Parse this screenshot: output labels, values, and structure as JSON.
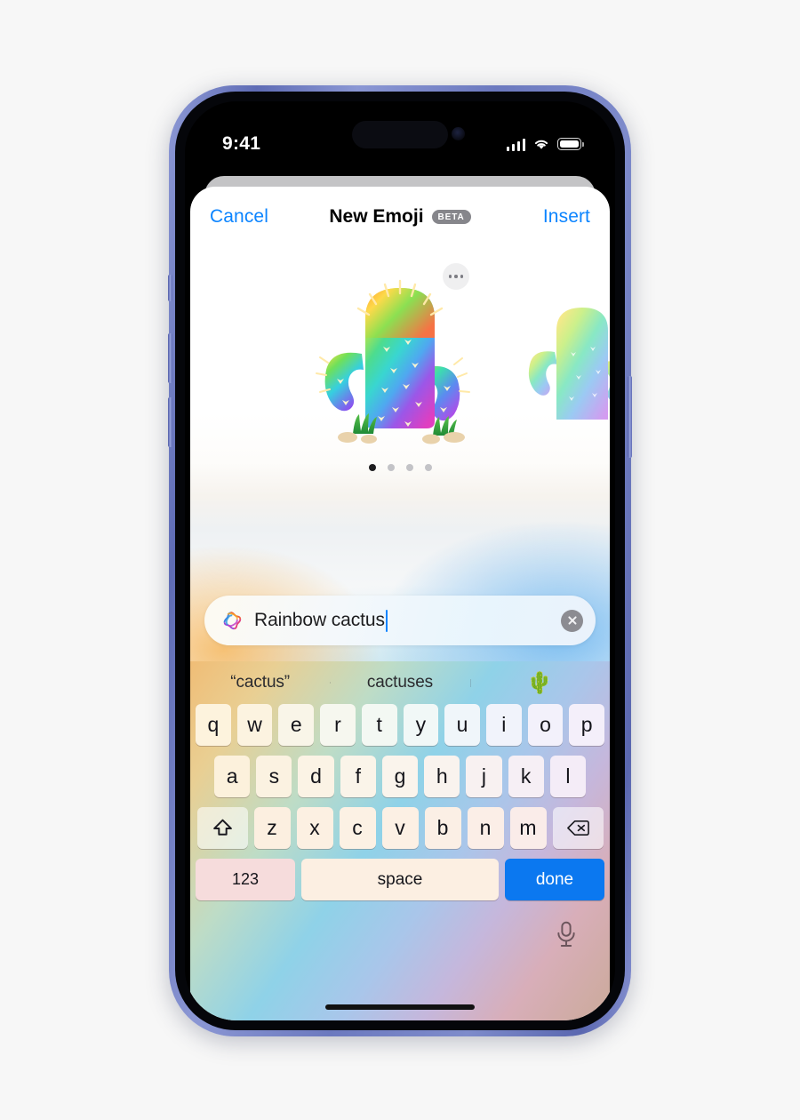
{
  "status_bar": {
    "time": "9:41",
    "signal_icon": "cellular-signal-icon",
    "wifi_icon": "wifi-icon",
    "battery_icon": "battery-full-icon"
  },
  "sheet": {
    "cancel_label": "Cancel",
    "title": "New Emoji",
    "beta_badge": "BETA",
    "insert_label": "Insert"
  },
  "canvas": {
    "more_options_icon": "ellipsis-icon",
    "primary_emoji_name": "rainbow-cactus-emoji",
    "secondary_emoji_name": "rainbow-cactus-emoji-variant",
    "page_count": 4,
    "active_page": 1
  },
  "prompt": {
    "ai_icon": "apple-intelligence-icon",
    "value": "Rainbow cactus",
    "clear_icon": "clear-text-icon"
  },
  "predictions": [
    {
      "label": "“cactus”",
      "type": "text"
    },
    {
      "label": "cactuses",
      "type": "text"
    },
    {
      "label": "🌵",
      "type": "emoji"
    }
  ],
  "keyboard": {
    "row1": [
      "q",
      "w",
      "e",
      "r",
      "t",
      "y",
      "u",
      "i",
      "o",
      "p"
    ],
    "row2": [
      "a",
      "s",
      "d",
      "f",
      "g",
      "h",
      "j",
      "k",
      "l"
    ],
    "row3": [
      "z",
      "x",
      "c",
      "v",
      "b",
      "n",
      "m"
    ],
    "shift_icon": "shift-icon",
    "delete_icon": "delete-backward-icon",
    "numbers_label": "123",
    "space_label": "space",
    "done_label": "done",
    "dictation_icon": "microphone-icon",
    "done_color": "#0b78f0"
  }
}
